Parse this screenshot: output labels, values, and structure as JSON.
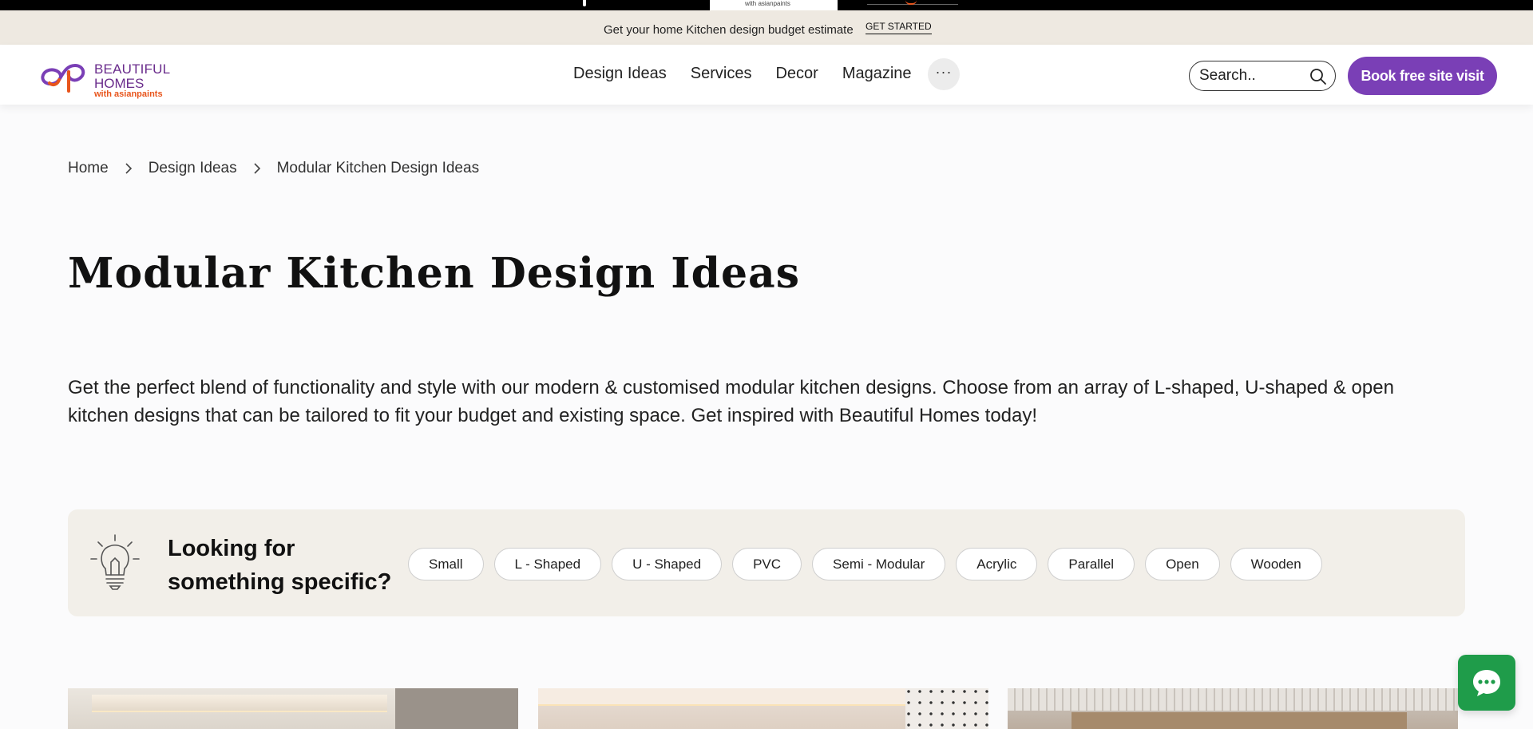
{
  "top_strip": {
    "partner_text": "with asianpaints"
  },
  "promo": {
    "text": "Get your home Kitchen design budget estimate",
    "cta": "GET STARTED"
  },
  "header": {
    "logo": {
      "line1": "BEAUTIFUL",
      "line2": "HOMES",
      "line3": "with asianpaints"
    },
    "nav": [
      {
        "label": "Design Ideas"
      },
      {
        "label": "Services"
      },
      {
        "label": "Decor"
      },
      {
        "label": "Magazine"
      }
    ],
    "more_label": "···",
    "search_placeholder": "Search..",
    "book_button": "Book free site visit"
  },
  "breadcrumb": [
    {
      "label": "Home"
    },
    {
      "label": "Design Ideas"
    },
    {
      "label": "Modular Kitchen Design Ideas"
    }
  ],
  "page_title": "Modular Kitchen Design Ideas",
  "intro": "Get the perfect blend of functionality and style with our modern & customised modular kitchen designs. Choose from an array of L-shaped, U-shaped & open kitchen designs that can be tailored to fit your budget and existing space. Get inspired with Beautiful Homes today!",
  "specific": {
    "heading": "Looking for something specific?",
    "chips": [
      "Small",
      "L - Shaped",
      "U - Shaped",
      "PVC",
      "Semi - Modular",
      "Acrylic",
      "Parallel",
      "Open",
      "Wooden"
    ]
  },
  "colors": {
    "brand_purple": "#7a3fb6",
    "logo_purple": "#6a2c8c",
    "logo_orange": "#e8551c",
    "chat_green": "#1f9c4a",
    "promo_bg": "#eee9e1",
    "specific_bg": "#f2efe9"
  },
  "icons": {
    "search": "search-icon",
    "more": "more-dots-icon",
    "breadcrumb_sep": "chevron-right-icon",
    "specific": "lightbulb-icon",
    "chat": "chat-bubble-icon"
  }
}
